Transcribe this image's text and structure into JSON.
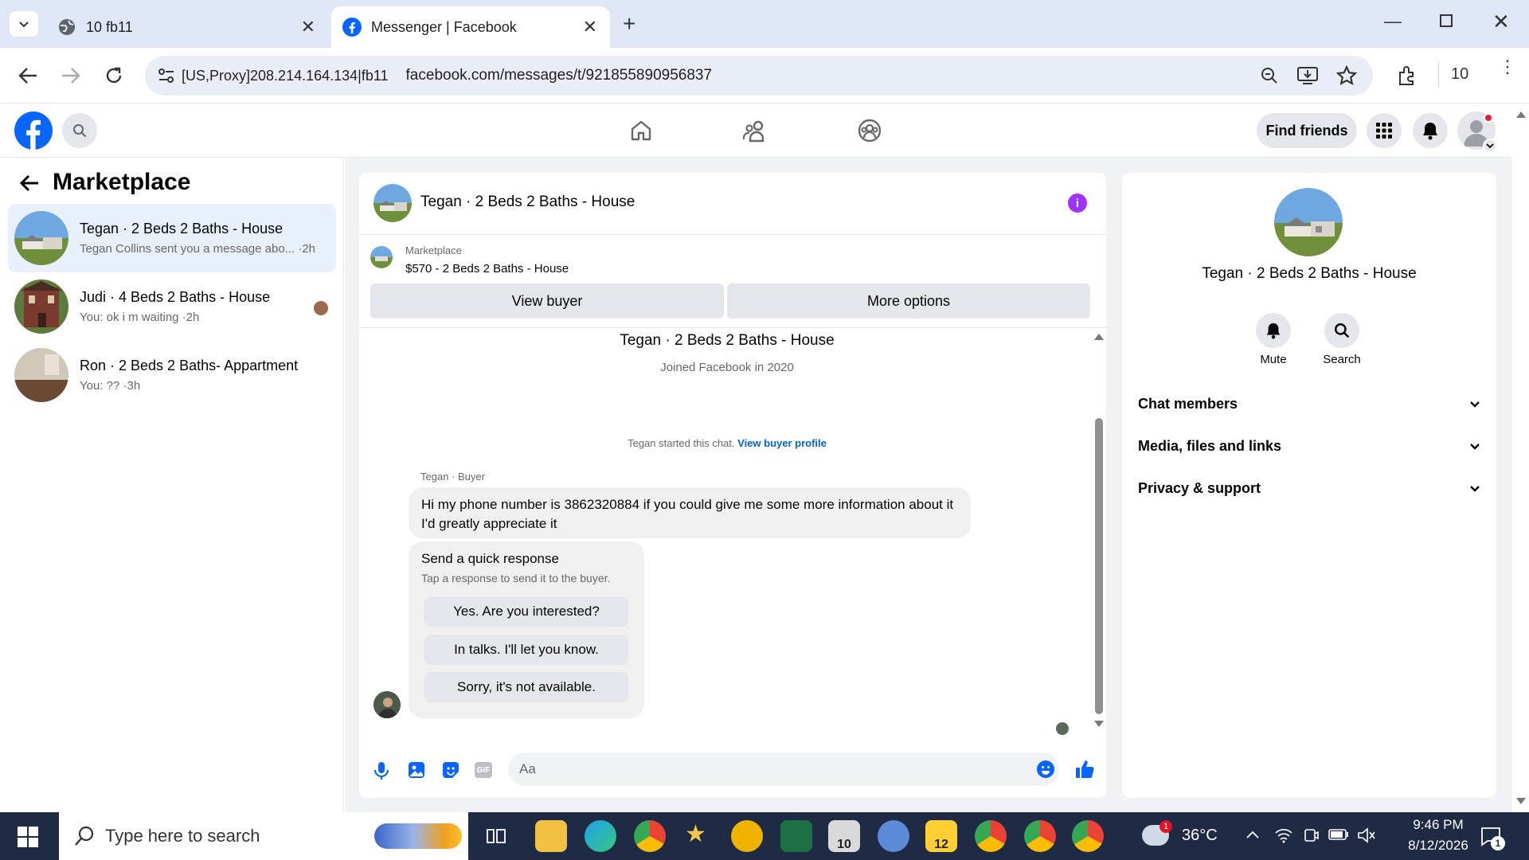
{
  "browser": {
    "tabs": [
      {
        "title": "10 fb11"
      },
      {
        "title": "Messenger | Facebook"
      }
    ],
    "address": {
      "prefix": "[US,Proxy]208.214.164.134|fb11",
      "url": "facebook.com/messages/t/921855890956837"
    },
    "profile_count": "10"
  },
  "fb_header": {
    "find_friends": "Find friends"
  },
  "sidebar": {
    "title": "Marketplace",
    "conversations": [
      {
        "title": "Tegan · 2 Beds 2 Baths - House",
        "snippet": "Tegan Collins sent you a message abo... ·2h"
      },
      {
        "title": "Judi · 4 Beds 2 Baths - House",
        "snippet": "You: ok i m waiting ·2h"
      },
      {
        "title": "Ron · 2 Beds 2 Baths- Appartment",
        "snippet": "You: ?? ·3h"
      }
    ]
  },
  "chat": {
    "header_title": "Tegan · 2 Beds 2 Baths - House",
    "listing": {
      "label": "Marketplace",
      "price_title": "$570 - 2 Beds 2 Baths - House",
      "view_buyer": "View buyer",
      "more_options": "More options"
    },
    "intro": {
      "name": "Tegan · 2 Beds 2 Baths - House",
      "joined": "Joined Facebook in 2020"
    },
    "started": {
      "text": "Tegan started this chat.",
      "link": "View buyer profile"
    },
    "sender_label": "Tegan · Buyer",
    "message": "Hi my phone number is 3862320884 if you could give me some more information about it I'd greatly appreciate it",
    "quick": {
      "title": "Send a quick response",
      "subtitle": "Tap a response to send it to the buyer.",
      "options": [
        "Yes. Are you interested?",
        "In talks. I'll let you know.",
        "Sorry, it's not available."
      ]
    },
    "composer_placeholder": "Aa"
  },
  "info_panel": {
    "name": "Tegan · 2 Beds 2 Baths - House",
    "mute": "Mute",
    "search": "Search",
    "sections": [
      "Chat members",
      "Media, files and links",
      "Privacy & support"
    ]
  },
  "taskbar": {
    "search_placeholder": "Type here to search",
    "weather": "36°C",
    "time": "9:46 PM",
    "date": "8/12/2026",
    "badge_10": "10",
    "badge_12": "12",
    "notif_count": "1"
  },
  "colors": {
    "fb_blue": "#0866ff",
    "messenger_purple": "#a033ff",
    "link_blue": "#0064d1"
  }
}
